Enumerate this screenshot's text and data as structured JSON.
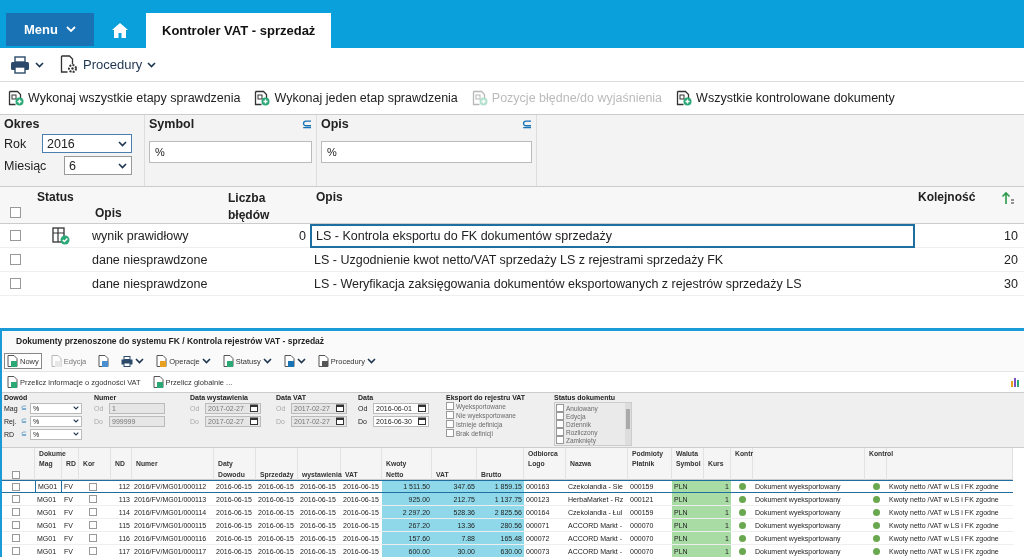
{
  "header": {
    "menu": "Menu",
    "tab": "Kontroler VAT - sprzedaż"
  },
  "toolbar": {
    "procedures": "Procedury"
  },
  "actions": [
    {
      "label": "Wykonaj wszystkie etapy sprawdzenia",
      "disabled": false
    },
    {
      "label": "Wykonaj jeden etap sprawdzenia",
      "disabled": false
    },
    {
      "label": "Pozycje błędne/do wyjaśnienia",
      "disabled": true
    },
    {
      "label": "Wszystkie kontrolowane dokumenty",
      "disabled": false
    }
  ],
  "filters": {
    "period": {
      "title": "Okres",
      "year_label": "Rok",
      "year": "2016",
      "month_label": "Miesiąc",
      "month": "6"
    },
    "symbol": {
      "title": "Symbol",
      "mode": "⊆",
      "value": "%"
    },
    "description": {
      "title": "Opis",
      "mode": "⊆",
      "value": "%"
    }
  },
  "steps": {
    "all_checked": false,
    "columns": {
      "status": "Status",
      "status_desc": "Opis",
      "errors": "Liczba błędów",
      "description": "Opis",
      "order": "Kolejność"
    },
    "rows": [
      {
        "checked": false,
        "verified": true,
        "status": "wynik prawidłowy",
        "errors": "0",
        "description": "LS - Kontrola eksportu do FK dokumentów sprzedaży",
        "order": "10",
        "selected": true
      },
      {
        "checked": false,
        "verified": false,
        "status": "dane niesprawdzone",
        "description": "LS - Uzgodnienie kwot netto/VAT sprzedaży LS  z rejestrami sprzedaży FK",
        "order": "20",
        "selected": false
      },
      {
        "checked": false,
        "verified": false,
        "status": "dane niesprawdzone",
        "description": "LS - Weryfikacja zaksięgowania dokumentów eksportowanych z rejestrów sprzedaży LS",
        "order": "30",
        "selected": false
      }
    ]
  },
  "documents": {
    "title": "Dokumenty przenoszone do systemu FK / Kontrola rejestrów VAT - sprzedaż",
    "toolbar": [
      {
        "kind": "new",
        "label": "Nowy",
        "disabled": false
      },
      {
        "kind": "edit",
        "label": "Edycja",
        "disabled": true
      },
      {
        "kind": "preview",
        "disabled": false
      },
      {
        "kind": "print",
        "disabled": false
      },
      {
        "kind": "operations",
        "label": "Operacje",
        "disabled": false
      },
      {
        "kind": "statuses",
        "label": "Statusy",
        "disabled": false
      },
      {
        "kind": "export",
        "disabled": false
      },
      {
        "kind": "procedures",
        "label": "Procedury",
        "disabled": false
      }
    ],
    "recalc": [
      "Przelicz informacje o zgodności VAT",
      "Przelicz globalnie ..."
    ],
    "proof": {
      "title": "Dowód",
      "rows": [
        {
          "label": "Mag",
          "mode": "⊆",
          "value": "%"
        },
        {
          "label": "Rej.",
          "mode": "⊆",
          "value": "%"
        },
        {
          "label": "RD",
          "mode": "⊆",
          "value": "%"
        }
      ]
    },
    "ranges": [
      {
        "kind": "number",
        "title": "Numer",
        "disabled": true,
        "from_label": "Od",
        "from": "1",
        "to_label": "Do",
        "to": "999999"
      },
      {
        "kind": "date",
        "title": "Data wystawienia",
        "disabled": true,
        "from_label": "Od",
        "from": "2017-02-27",
        "to_label": "Do",
        "to": "2017-02-27"
      },
      {
        "kind": "date",
        "title": "Data VAT",
        "disabled": true,
        "from_label": "Od",
        "from": "2017-02-27",
        "to_label": "Do",
        "to": "2017-02-27"
      },
      {
        "kind": "date",
        "title": "Data",
        "disabled": false,
        "from_label": "Od",
        "from": "2016-06-01",
        "to_label": "Do",
        "to": "2016-06-30"
      }
    ],
    "export": {
      "title": "Eksport do rejestru VAT",
      "disabled": true,
      "options": [
        {
          "label": "Wyeksportowane",
          "checked": false
        },
        {
          "label": "Nie wyeksportowane",
          "checked": false
        },
        {
          "label": "Istnieje definicja",
          "checked": false
        },
        {
          "label": "Brak definicji",
          "checked": false
        }
      ]
    },
    "status": {
      "title": "Status dokumentu",
      "disabled": true,
      "options": [
        {
          "label": "Anulowany",
          "checked": false
        },
        {
          "label": "Edycja",
          "checked": false
        },
        {
          "label": "Dziennik",
          "checked": false
        },
        {
          "label": "Rozliczony",
          "checked": false
        },
        {
          "label": "Zamknięty",
          "checked": false
        }
      ]
    },
    "grid": {
      "all_checked": false,
      "columns": [
        {},
        {
          "h1": "Dokume",
          "h2": "Mag"
        },
        {
          "h2": "RD"
        },
        {
          "h2": "Kor"
        },
        {
          "h2": "ND"
        },
        {
          "h2": "Numer"
        },
        {
          "h2": "Daty",
          "h3": "Dowodu"
        },
        {
          "h3": "Sprzedaży"
        },
        {
          "h3": "wystawienia"
        },
        {
          "h3": "VAT"
        },
        {
          "h2": "Kwoty",
          "h3": "Netto"
        },
        {
          "h3": "VAT"
        },
        {
          "h3": "Brutto"
        },
        {
          "h1": "Odbiorca",
          "h2": "Logo"
        },
        {
          "h2": "Nazwa"
        },
        {
          "h1": "Podmioty",
          "h2": "Płatnik"
        },
        {
          "h1": "Waluta",
          "h2": "Symbol"
        },
        {
          "h2": "Kurs"
        },
        {
          "h1": "Kontr"
        },
        {},
        {
          "h1": "Kontrol"
        },
        {}
      ],
      "rows": [
        {
          "checked": false,
          "selected": true,
          "mag": "MG01",
          "rd": "FV",
          "kor": false,
          "nd": "112",
          "numer": "2016/FV/MG01/000112",
          "dates": [
            "2016-06-15",
            "2016-06-15",
            "2016-06-15",
            "2016-06-15"
          ],
          "amounts": [
            "1 511.50",
            "347.65",
            "1 859.15"
          ],
          "logo": "000163",
          "nazwa": "Czekolandia - Sie",
          "platnik": "000159",
          "symbol": "PLN",
          "kurs": "1",
          "export_status": {
            "color": "#6aa84f",
            "text": "Dokument wyeksportowany"
          },
          "vat_check": {
            "color": "#6aa84f",
            "text": "Kwoty netto /VAT w LS i FK zgodne"
          }
        },
        {
          "checked": false,
          "selected": false,
          "mag": "MG01",
          "rd": "FV",
          "kor": false,
          "nd": "113",
          "numer": "2016/FV/MG01/000113",
          "dates": [
            "2016-06-15",
            "2016-06-15",
            "2016-06-15",
            "2016-06-15"
          ],
          "amounts": [
            "925.00",
            "212.75",
            "1 137.75"
          ],
          "logo": "000123",
          "nazwa": "HerbaMarket - Rz",
          "platnik": "000121",
          "symbol": "PLN",
          "kurs": "1",
          "export_status": {
            "color": "#6aa84f",
            "text": "Dokument wyeksportowany"
          },
          "vat_check": {
            "color": "#6aa84f",
            "text": "Kwoty netto /VAT w LS i FK zgodne"
          }
        },
        {
          "checked": false,
          "selected": false,
          "mag": "MG01",
          "rd": "FV",
          "kor": false,
          "nd": "114",
          "numer": "2016/FV/MG01/000114",
          "dates": [
            "2016-06-15",
            "2016-06-15",
            "2016-06-15",
            "2016-06-15"
          ],
          "amounts": [
            "2 297.20",
            "528.36",
            "2 825.56"
          ],
          "logo": "000164",
          "nazwa": "Czekolandia - Łul",
          "platnik": "000159",
          "symbol": "PLN",
          "kurs": "1",
          "export_status": {
            "color": "#6aa84f",
            "text": "Dokument wyeksportowany"
          },
          "vat_check": {
            "color": "#6aa84f",
            "text": "Kwoty netto /VAT w LS i FK zgodne"
          }
        },
        {
          "checked": false,
          "selected": false,
          "mag": "MG01",
          "rd": "FV",
          "kor": false,
          "nd": "115",
          "numer": "2016/FV/MG01/000115",
          "dates": [
            "2016-06-15",
            "2016-06-15",
            "2016-06-15",
            "2016-06-15"
          ],
          "amounts": [
            "267.20",
            "13.36",
            "280.56"
          ],
          "logo": "000071",
          "nazwa": "ACCORD Markt -",
          "platnik": "000070",
          "symbol": "PLN",
          "kurs": "1",
          "export_status": {
            "color": "#6aa84f",
            "text": "Dokument wyeksportowany"
          },
          "vat_check": {
            "color": "#6aa84f",
            "text": "Kwoty netto /VAT w LS i FK zgodne"
          }
        },
        {
          "checked": false,
          "selected": false,
          "mag": "MG01",
          "rd": "FV",
          "kor": false,
          "nd": "116",
          "numer": "2016/FV/MG01/000116",
          "dates": [
            "2016-06-15",
            "2016-06-15",
            "2016-06-15",
            "2016-06-15"
          ],
          "amounts": [
            "157.60",
            "7.88",
            "165.48"
          ],
          "logo": "000072",
          "nazwa": "ACCORD Markt -",
          "platnik": "000070",
          "symbol": "PLN",
          "kurs": "1",
          "export_status": {
            "color": "#6aa84f",
            "text": "Dokument wyeksportowany"
          },
          "vat_check": {
            "color": "#6aa84f",
            "text": "Kwoty netto /VAT w LS i FK zgodne"
          }
        },
        {
          "checked": false,
          "selected": false,
          "mag": "MG01",
          "rd": "FV",
          "kor": false,
          "nd": "117",
          "numer": "2016/FV/MG01/000117",
          "dates": [
            "2016-06-15",
            "2016-06-15",
            "2016-06-15",
            "2016-06-15"
          ],
          "amounts": [
            "600.00",
            "30.00",
            "630.00"
          ],
          "logo": "000073",
          "nazwa": "ACCORD Markt -",
          "platnik": "000070",
          "symbol": "PLN",
          "kurs": "1",
          "export_status": {
            "color": "#6aa84f",
            "text": "Dokument wyeksportowany"
          },
          "vat_check": {
            "color": "#6aa84f",
            "text": "Kwoty netto /VAT w LS i FK zgodne"
          }
        }
      ]
    }
  }
}
